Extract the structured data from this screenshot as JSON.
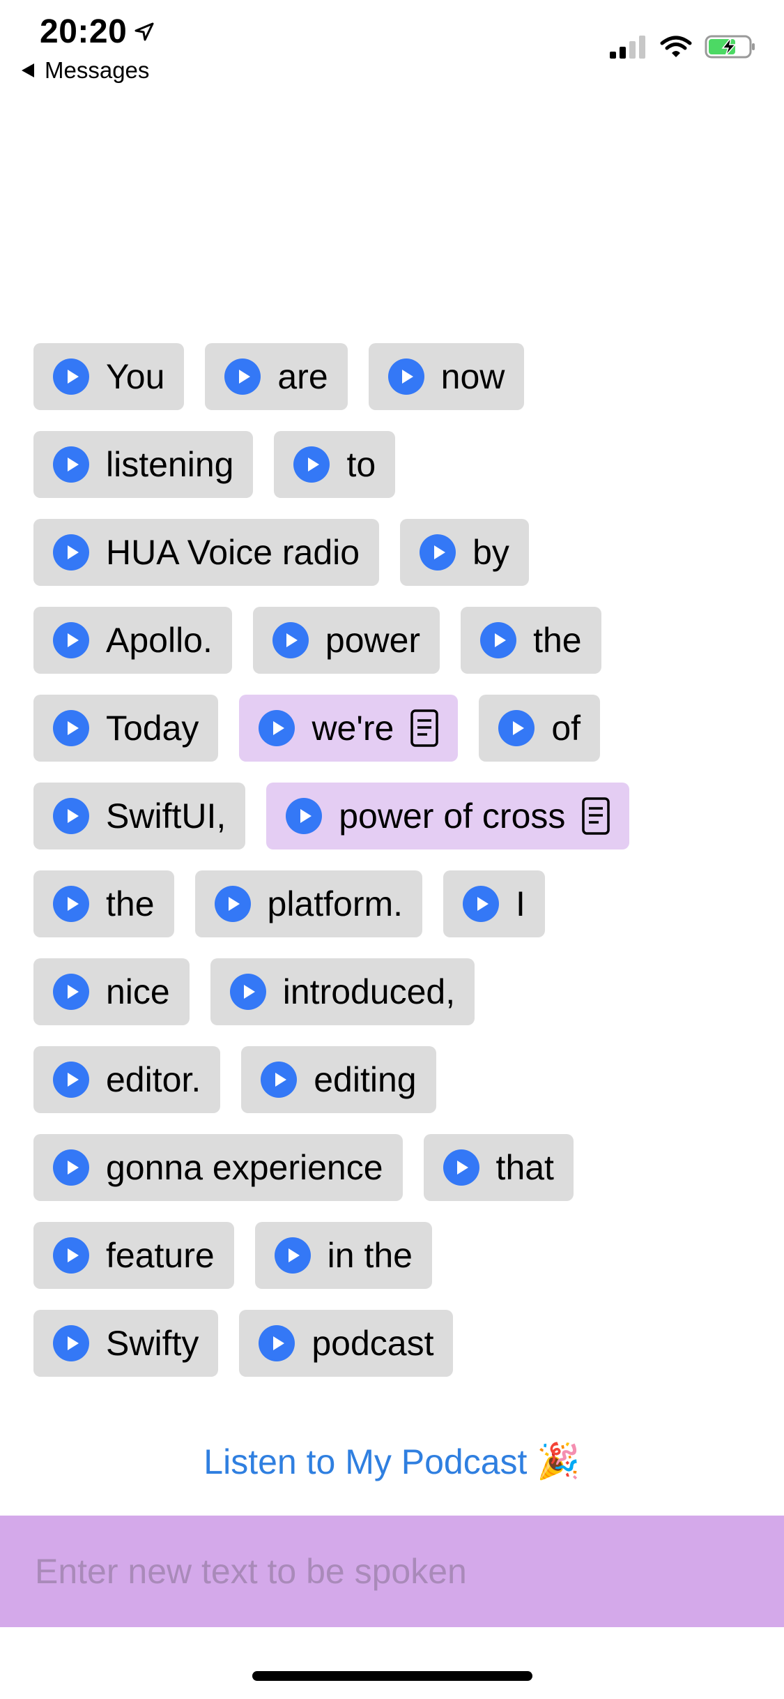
{
  "status_bar": {
    "time": "20:20",
    "back_label": "Messages"
  },
  "rows": [
    [
      {
        "label": "You"
      },
      {
        "label": "are"
      },
      {
        "label": "now"
      }
    ],
    [
      {
        "label": "listening"
      },
      {
        "label": "to"
      }
    ],
    [
      {
        "label": "HUA Voice radio"
      },
      {
        "label": "by"
      }
    ],
    [
      {
        "label": "Apollo."
      },
      {
        "label": "power"
      },
      {
        "label": "the"
      }
    ],
    [
      {
        "label": "Today"
      },
      {
        "label": "we're",
        "selected": true
      },
      {
        "label": "of"
      }
    ],
    [
      {
        "label": "SwiftUI,"
      },
      {
        "label": "power of cross",
        "selected": true
      }
    ],
    [
      {
        "label": "the"
      },
      {
        "label": "platform."
      },
      {
        "label": "I"
      }
    ],
    [
      {
        "label": "nice"
      },
      {
        "label": "introduced,"
      }
    ],
    [
      {
        "label": "editor."
      },
      {
        "label": "editing"
      }
    ],
    [
      {
        "label": "gonna experience"
      },
      {
        "label": "that"
      }
    ],
    [
      {
        "label": "feature"
      },
      {
        "label": "in the"
      }
    ],
    [
      {
        "label": "Swifty"
      },
      {
        "label": "podcast"
      }
    ]
  ],
  "listen_link": {
    "label": "Listen to My Podcast",
    "emoji": "🎉"
  },
  "input": {
    "placeholder": "Enter new text to be spoken",
    "value": ""
  },
  "colors": {
    "chip": "#dcdcdc",
    "chip_selected": "#e4cdf3",
    "play": "#3478f6",
    "link": "#2f7fe0",
    "input_bar": "#d4a9ea"
  }
}
